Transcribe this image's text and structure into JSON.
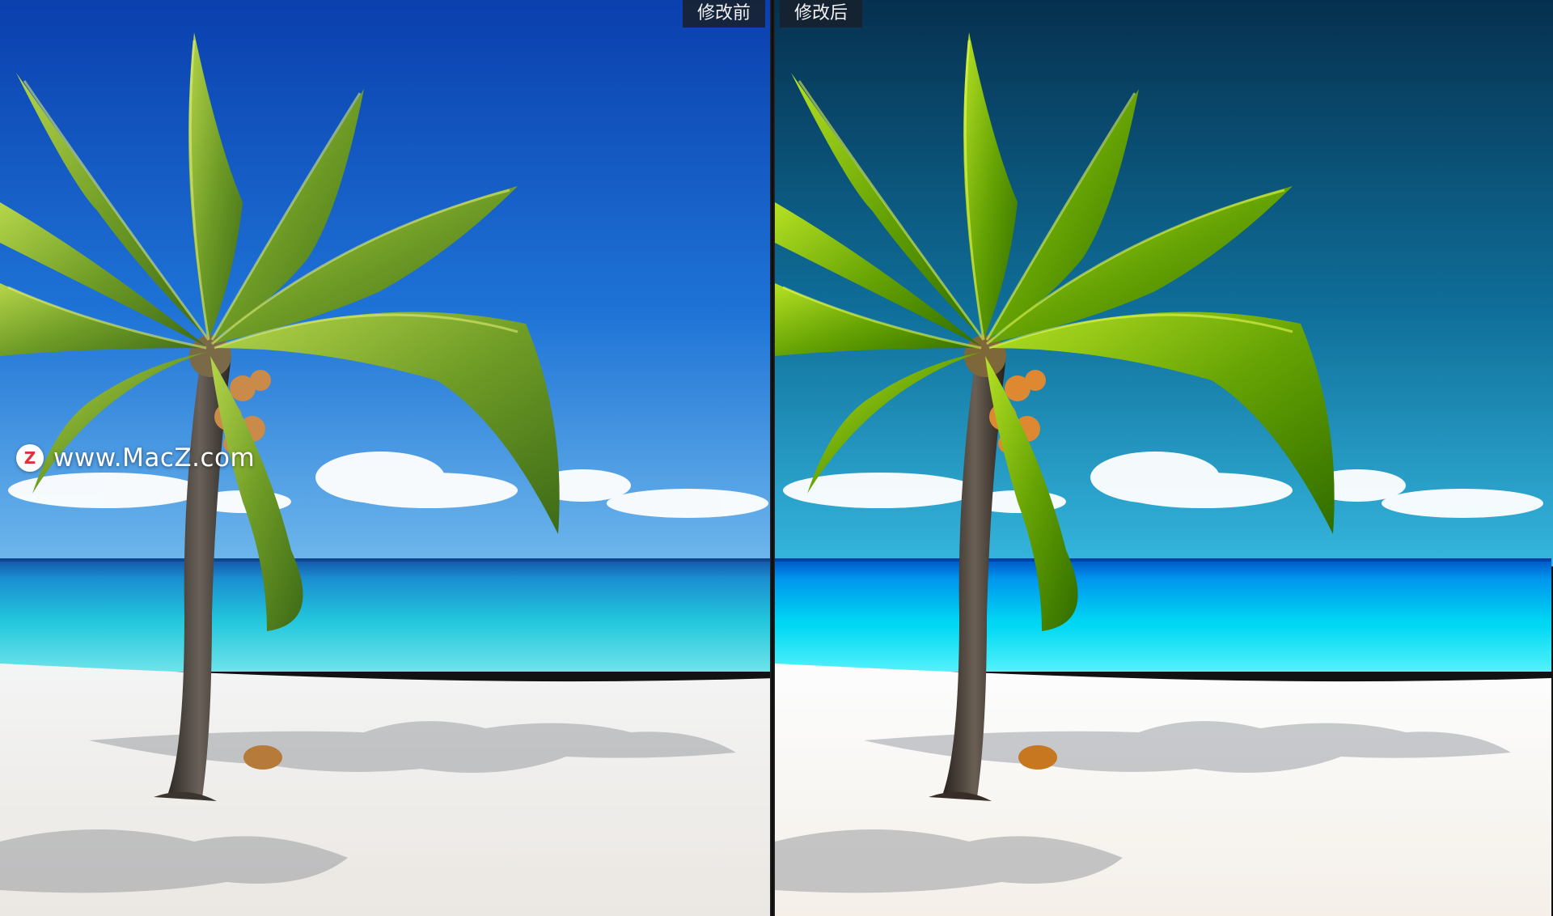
{
  "compare": {
    "before_label": "修改前",
    "after_label": "修改后"
  },
  "watermark": {
    "logo_letter": "Z",
    "text": "www.MacZ.com"
  },
  "colors": {
    "before_sky_top": "#0a3fae",
    "before_sky_bottom": "#4a9ee8",
    "after_sky_top": "#06304f",
    "after_sky_bottom": "#2ab0dc",
    "sea": "#24c8d6",
    "sand": "#f4f2ee",
    "label_bg": "#18202c",
    "logo_red": "#e0303a"
  },
  "icons": [
    "macz-logo-icon"
  ]
}
